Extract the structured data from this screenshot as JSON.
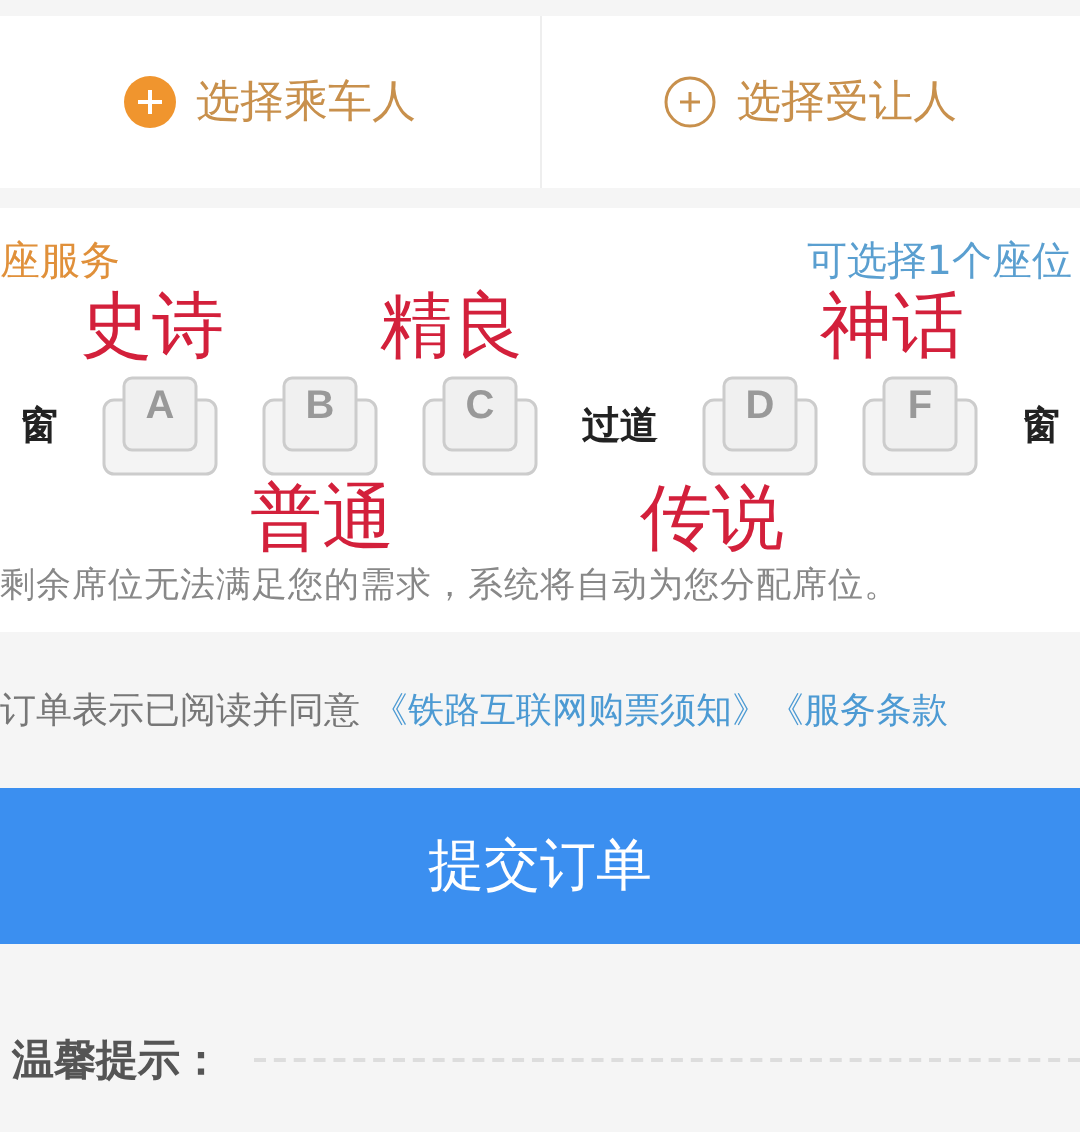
{
  "passenger_actions": [
    {
      "label": "选择乘车人",
      "kind": "filled"
    },
    {
      "label": "选择受让人",
      "kind": "outline"
    }
  ],
  "seat_service": {
    "title": "座服务",
    "hint": "可选择1个座位",
    "row": [
      {
        "kind": "label",
        "text": "窗"
      },
      {
        "kind": "seat",
        "text": "A",
        "selected": false
      },
      {
        "kind": "seat",
        "text": "B",
        "selected": false
      },
      {
        "kind": "seat",
        "text": "C",
        "selected": false
      },
      {
        "kind": "label",
        "text": "过道"
      },
      {
        "kind": "seat",
        "text": "D",
        "selected": false
      },
      {
        "kind": "seat",
        "text": "F",
        "selected": false
      },
      {
        "kind": "label",
        "text": "窗"
      }
    ],
    "note": "剩余席位无法满足您的需求，系统将自动为您分配席位。"
  },
  "overlay_captions": [
    {
      "text": "史诗"
    },
    {
      "text": "精良"
    },
    {
      "text": "神话"
    },
    {
      "text": "普通"
    },
    {
      "text": "传说"
    }
  ],
  "agreement": {
    "text": "订单表示已阅读并同意",
    "links": [
      "《铁路互联网购票须知》",
      "《服务条款"
    ]
  },
  "submit_button": "提交订单",
  "tips_title": "温馨提示："
}
